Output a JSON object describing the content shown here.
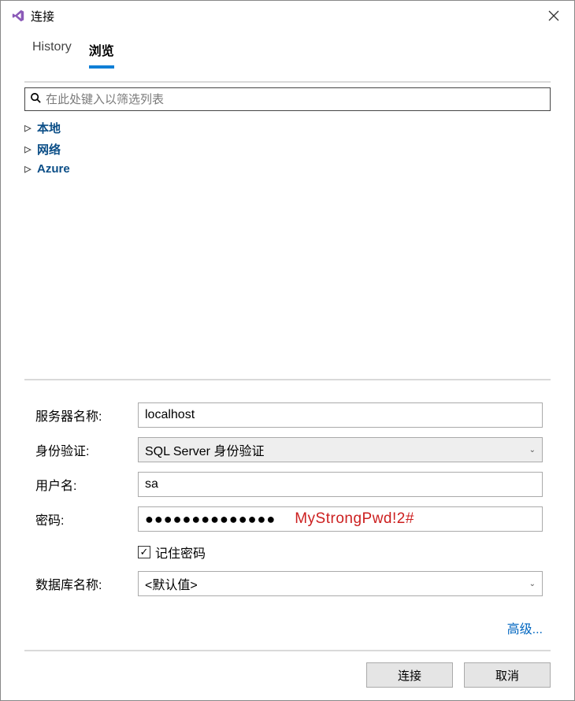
{
  "titlebar": {
    "title": "连接"
  },
  "tabs": {
    "history": "History",
    "browse": "浏览"
  },
  "search": {
    "placeholder": "在此处键入以筛选列表"
  },
  "tree": {
    "items": [
      {
        "label": "本地"
      },
      {
        "label": "网络"
      },
      {
        "label": "Azure"
      }
    ]
  },
  "form": {
    "server_label": "服务器名称:",
    "server_value": "localhost",
    "auth_label": "身份验证:",
    "auth_value": "SQL Server 身份验证",
    "user_label": "用户名:",
    "user_value": "sa",
    "password_label": "密码:",
    "password_mask": "●●●●●●●●●●●●●●",
    "password_overlay": "MyStrongPwd!2#",
    "remember_label": "记住密码",
    "remember_checked": true,
    "database_label": "数据库名称:",
    "database_value": "<默认值>",
    "advanced_label": "高级..."
  },
  "buttons": {
    "connect": "连接",
    "cancel": "取消"
  }
}
